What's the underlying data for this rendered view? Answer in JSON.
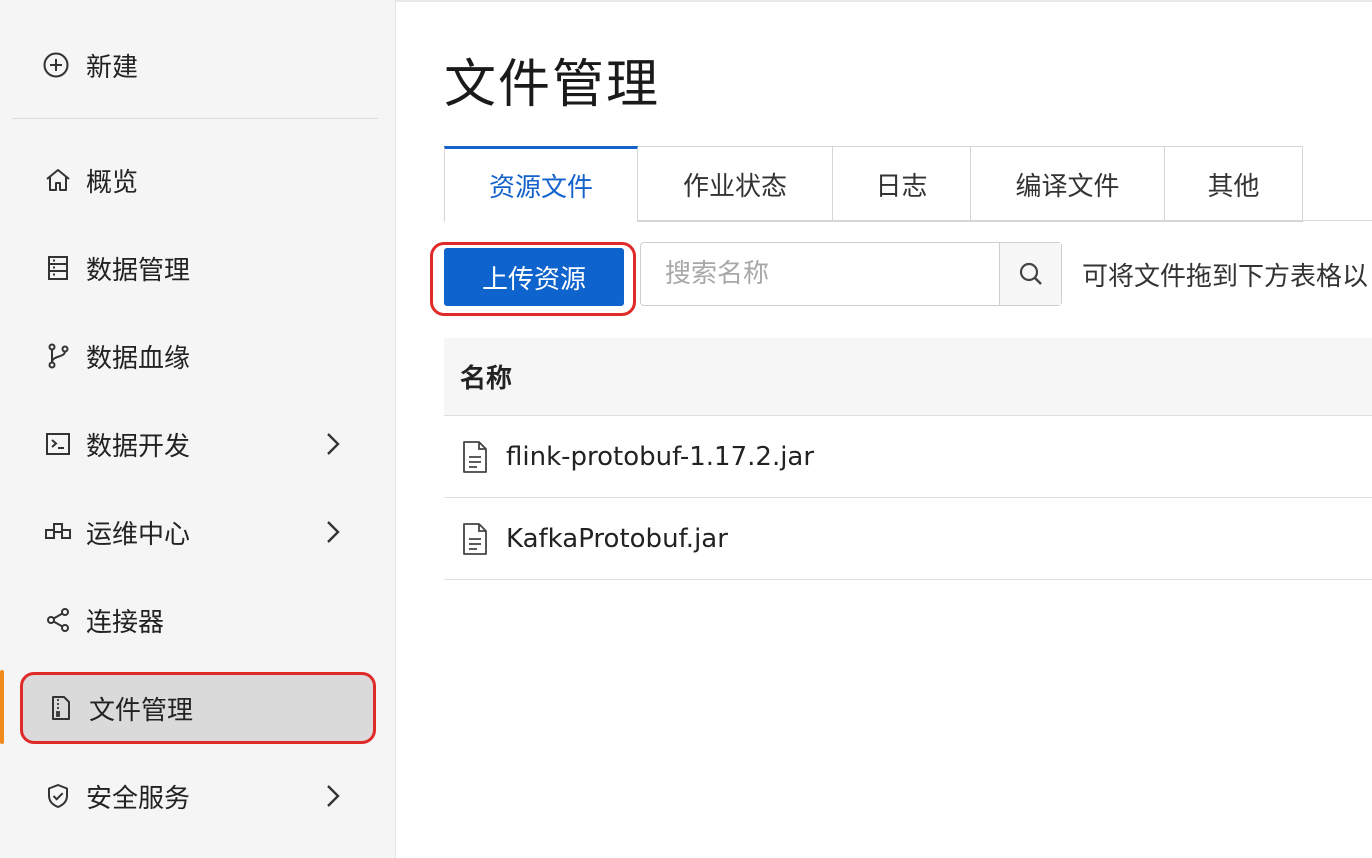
{
  "sidebar": {
    "new_label": "新建",
    "items": [
      {
        "label": "概览",
        "icon": "home-icon",
        "has_chevron": false
      },
      {
        "label": "数据管理",
        "icon": "database-icon",
        "has_chevron": false
      },
      {
        "label": "数据血缘",
        "icon": "lineage-icon",
        "has_chevron": false
      },
      {
        "label": "数据开发",
        "icon": "terminal-icon",
        "has_chevron": true
      },
      {
        "label": "运维中心",
        "icon": "ops-icon",
        "has_chevron": true
      },
      {
        "label": "连接器",
        "icon": "share-icon",
        "has_chevron": false
      },
      {
        "label": "文件管理",
        "icon": "file-manage-icon",
        "has_chevron": false,
        "active": true
      },
      {
        "label": "安全服务",
        "icon": "shield-icon",
        "has_chevron": true
      }
    ]
  },
  "main": {
    "title": "文件管理",
    "tabs": [
      {
        "label": "资源文件",
        "active": true
      },
      {
        "label": "作业状态",
        "active": false
      },
      {
        "label": "日志",
        "active": false
      },
      {
        "label": "编译文件",
        "active": false
      },
      {
        "label": "其他",
        "active": false
      }
    ],
    "upload_label": "上传资源",
    "search_placeholder": "搜索名称",
    "drop_hint": "可将文件拖到下方表格以",
    "table": {
      "header": "名称",
      "rows": [
        {
          "name": "flink-protobuf-1.17.2.jar"
        },
        {
          "name": "KafkaProtobuf.jar"
        }
      ]
    }
  },
  "colors": {
    "accent": "#1463cc",
    "primary_button": "#0f63cc",
    "highlight_outline": "#e02a2a",
    "active_bar": "#f28a1c"
  }
}
